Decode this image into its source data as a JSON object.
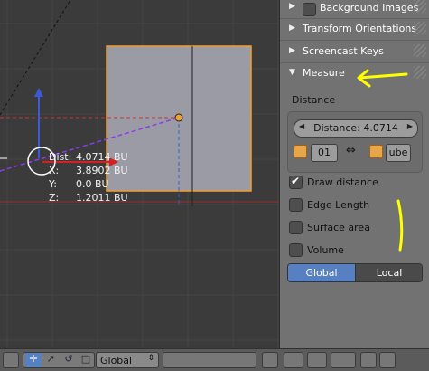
{
  "viewport": {
    "readout": {
      "dist_label": "Dist:",
      "dist_value": "4.0714 BU",
      "x_label": "X:",
      "x_value": "3.8902 BU",
      "y_label": "Y:",
      "y_value": "0.0 BU",
      "z_label": "Z:",
      "z_value": "1.2011 BU"
    }
  },
  "panel": {
    "sections": [
      {
        "label": "Background Images",
        "collapsed": true,
        "has_checkbox": true
      },
      {
        "label": "Transform Orientations",
        "collapsed": true
      },
      {
        "label": "Screencast Keys",
        "collapsed": true
      },
      {
        "label": "Measure",
        "collapsed": false
      }
    ],
    "measure": {
      "distance_heading": "Distance",
      "distance_field": "Distance: 4.0714",
      "object_a": "01",
      "object_b": "ube",
      "options": [
        {
          "label": "Draw distance",
          "checked": true
        },
        {
          "label": "Edge Length",
          "checked": false
        },
        {
          "label": "Surface area",
          "checked": false
        },
        {
          "label": "Volume",
          "checked": false
        }
      ],
      "space_options": [
        "Global",
        "Local"
      ],
      "space_selected": "Global"
    }
  },
  "toolbar": {
    "orientation_select": "Global"
  },
  "colors": {
    "annotation_yellow": "#ffff00",
    "selection_orange": "#f0a030",
    "toggle_active_blue": "#5680c2"
  }
}
